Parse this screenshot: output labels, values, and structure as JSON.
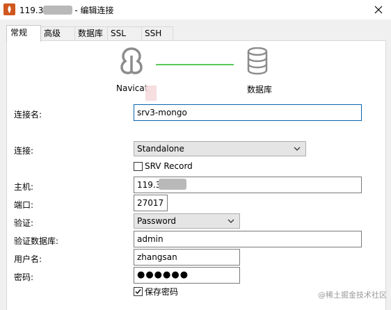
{
  "window": {
    "title_prefix": "119.3",
    "title_suffix": "- 编辑连接"
  },
  "tabs": [
    {
      "label": "常规",
      "active": true
    },
    {
      "label": "高级"
    },
    {
      "label": "数据库"
    },
    {
      "label": "SSL"
    },
    {
      "label": "SSH"
    }
  ],
  "graphic": {
    "left_label": "Navicat",
    "right_label": "数据库",
    "line_color": "#5ac85a"
  },
  "form": {
    "conn_name_label": "连接名:",
    "conn_name_value": "srv3-mongo",
    "connection_label": "连接:",
    "connection_value": "Standalone",
    "srv_record_label": "SRV Record",
    "srv_record_checked": false,
    "host_label": "主机:",
    "host_value": "119.3",
    "port_label": "端口:",
    "port_value": "27017",
    "auth_label": "验证:",
    "auth_value": "Password",
    "auth_db_label": "验证数据库:",
    "auth_db_value": "admin",
    "username_label": "用户名:",
    "username_value": "zhangsan",
    "password_label": "密码:",
    "password_value": "●●●●●●",
    "save_password_label": "保存密码",
    "save_password_checked": true
  },
  "watermark": "@稀土掘金技术社区",
  "icons": {
    "app": "navicat-app-icon",
    "close": "close-icon",
    "navicat": "navicat-logo-icon",
    "database": "database-icon",
    "dropdown": "chevron-down-icon",
    "check": "check-icon"
  }
}
